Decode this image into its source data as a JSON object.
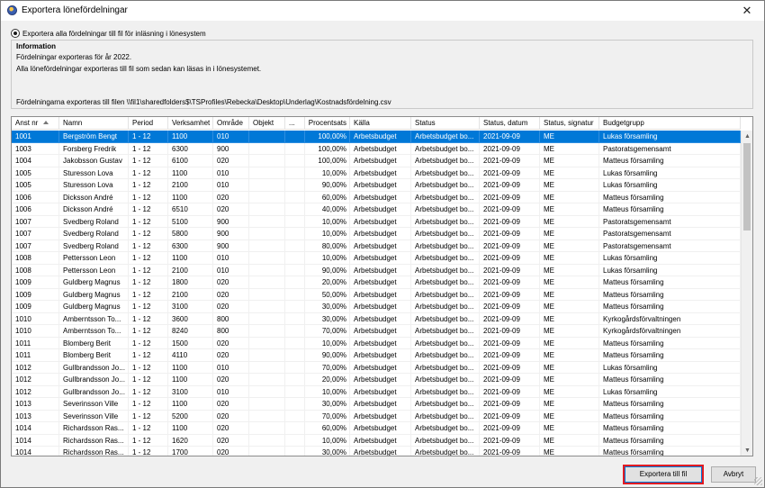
{
  "window": {
    "title": "Exportera lönefördelningar"
  },
  "option": {
    "label": "Exportera alla fördelningar till fil för inläsning i lönesystem"
  },
  "info": {
    "heading": "Information",
    "line1": "Fördelningar exporteras för år 2022.",
    "line2": "Alla lönefördelningar exporteras till fil som sedan kan läsas in i lönesystemet.",
    "line3": "Fördelningarna exporteras till filen \\\\fil1\\sharedfolders$\\TSProfiles\\Rebecka\\Desktop\\Underlag\\Kostnadsfördelning.csv"
  },
  "table": {
    "headers": [
      "Anst nr",
      "Namn",
      "Period",
      "Verksamhet",
      "Område",
      "Objekt",
      "...",
      "Procentsats",
      "Källa",
      "Status",
      "Status, datum",
      "Status, signatur",
      "Budgetgrupp"
    ],
    "rows": [
      [
        "1001",
        "Bergström Bengt",
        "1 - 12",
        "1100",
        "010",
        "",
        "",
        "100,00%",
        "Arbetsbudget",
        "Arbetsbudget bo...",
        "2021-09-09",
        "ME",
        "Lukas församling"
      ],
      [
        "1003",
        "Forsberg Fredrik",
        "1 - 12",
        "6300",
        "900",
        "",
        "",
        "100,00%",
        "Arbetsbudget",
        "Arbetsbudget bo...",
        "2021-09-09",
        "ME",
        "Pastoratsgemensamt"
      ],
      [
        "1004",
        "Jakobsson Gustav",
        "1 - 12",
        "6100",
        "020",
        "",
        "",
        "100,00%",
        "Arbetsbudget",
        "Arbetsbudget bo...",
        "2021-09-09",
        "ME",
        "Matteus församling"
      ],
      [
        "1005",
        "Sturesson Lova",
        "1 - 12",
        "1100",
        "010",
        "",
        "",
        "10,00%",
        "Arbetsbudget",
        "Arbetsbudget bo...",
        "2021-09-09",
        "ME",
        "Lukas församling"
      ],
      [
        "1005",
        "Sturesson Lova",
        "1 - 12",
        "2100",
        "010",
        "",
        "",
        "90,00%",
        "Arbetsbudget",
        "Arbetsbudget bo...",
        "2021-09-09",
        "ME",
        "Lukas församling"
      ],
      [
        "1006",
        "Dicksson André",
        "1 - 12",
        "1100",
        "020",
        "",
        "",
        "60,00%",
        "Arbetsbudget",
        "Arbetsbudget bo...",
        "2021-09-09",
        "ME",
        "Matteus församling"
      ],
      [
        "1006",
        "Dicksson André",
        "1 - 12",
        "6510",
        "020",
        "",
        "",
        "40,00%",
        "Arbetsbudget",
        "Arbetsbudget bo...",
        "2021-09-09",
        "ME",
        "Matteus församling"
      ],
      [
        "1007",
        "Svedberg Roland",
        "1 - 12",
        "5100",
        "900",
        "",
        "",
        "10,00%",
        "Arbetsbudget",
        "Arbetsbudget bo...",
        "2021-09-09",
        "ME",
        "Pastoratsgemensamt"
      ],
      [
        "1007",
        "Svedberg Roland",
        "1 - 12",
        "5800",
        "900",
        "",
        "",
        "10,00%",
        "Arbetsbudget",
        "Arbetsbudget bo...",
        "2021-09-09",
        "ME",
        "Pastoratsgemensamt"
      ],
      [
        "1007",
        "Svedberg Roland",
        "1 - 12",
        "6300",
        "900",
        "",
        "",
        "80,00%",
        "Arbetsbudget",
        "Arbetsbudget bo...",
        "2021-09-09",
        "ME",
        "Pastoratsgemensamt"
      ],
      [
        "1008",
        "Pettersson Leon",
        "1 - 12",
        "1100",
        "010",
        "",
        "",
        "10,00%",
        "Arbetsbudget",
        "Arbetsbudget bo...",
        "2021-09-09",
        "ME",
        "Lukas församling"
      ],
      [
        "1008",
        "Pettersson Leon",
        "1 - 12",
        "2100",
        "010",
        "",
        "",
        "90,00%",
        "Arbetsbudget",
        "Arbetsbudget bo...",
        "2021-09-09",
        "ME",
        "Lukas församling"
      ],
      [
        "1009",
        "Guldberg Magnus",
        "1 - 12",
        "1800",
        "020",
        "",
        "",
        "20,00%",
        "Arbetsbudget",
        "Arbetsbudget bo...",
        "2021-09-09",
        "ME",
        "Matteus församling"
      ],
      [
        "1009",
        "Guldberg Magnus",
        "1 - 12",
        "2100",
        "020",
        "",
        "",
        "50,00%",
        "Arbetsbudget",
        "Arbetsbudget bo...",
        "2021-09-09",
        "ME",
        "Matteus församling"
      ],
      [
        "1009",
        "Guldberg Magnus",
        "1 - 12",
        "3100",
        "020",
        "",
        "",
        "30,00%",
        "Arbetsbudget",
        "Arbetsbudget bo...",
        "2021-09-09",
        "ME",
        "Matteus församling"
      ],
      [
        "1010",
        "Amberntsson To...",
        "1 - 12",
        "3600",
        "800",
        "",
        "",
        "30,00%",
        "Arbetsbudget",
        "Arbetsbudget bo...",
        "2021-09-09",
        "ME",
        "Kyrkogårdsförvaltningen"
      ],
      [
        "1010",
        "Amberntsson To...",
        "1 - 12",
        "8240",
        "800",
        "",
        "",
        "70,00%",
        "Arbetsbudget",
        "Arbetsbudget bo...",
        "2021-09-09",
        "ME",
        "Kyrkogårdsförvaltningen"
      ],
      [
        "1011",
        "Blomberg Berit",
        "1 - 12",
        "1500",
        "020",
        "",
        "",
        "10,00%",
        "Arbetsbudget",
        "Arbetsbudget bo...",
        "2021-09-09",
        "ME",
        "Matteus församling"
      ],
      [
        "1011",
        "Blomberg Berit",
        "1 - 12",
        "4110",
        "020",
        "",
        "",
        "90,00%",
        "Arbetsbudget",
        "Arbetsbudget bo...",
        "2021-09-09",
        "ME",
        "Matteus församling"
      ],
      [
        "1012",
        "Gullbrandsson Jo...",
        "1 - 12",
        "1100",
        "010",
        "",
        "",
        "70,00%",
        "Arbetsbudget",
        "Arbetsbudget bo...",
        "2021-09-09",
        "ME",
        "Lukas församling"
      ],
      [
        "1012",
        "Gullbrandsson Jo...",
        "1 - 12",
        "1100",
        "020",
        "",
        "",
        "20,00%",
        "Arbetsbudget",
        "Arbetsbudget bo...",
        "2021-09-09",
        "ME",
        "Matteus församling"
      ],
      [
        "1012",
        "Gullbrandsson Jo...",
        "1 - 12",
        "3100",
        "010",
        "",
        "",
        "10,00%",
        "Arbetsbudget",
        "Arbetsbudget bo...",
        "2021-09-09",
        "ME",
        "Lukas församling"
      ],
      [
        "1013",
        "Severinsson Ville",
        "1 - 12",
        "1100",
        "020",
        "",
        "",
        "30,00%",
        "Arbetsbudget",
        "Arbetsbudget bo...",
        "2021-09-09",
        "ME",
        "Matteus församling"
      ],
      [
        "1013",
        "Severinsson Ville",
        "1 - 12",
        "5200",
        "020",
        "",
        "",
        "70,00%",
        "Arbetsbudget",
        "Arbetsbudget bo...",
        "2021-09-09",
        "ME",
        "Matteus församling"
      ],
      [
        "1014",
        "Richardsson Ras...",
        "1 - 12",
        "1100",
        "020",
        "",
        "",
        "60,00%",
        "Arbetsbudget",
        "Arbetsbudget bo...",
        "2021-09-09",
        "ME",
        "Matteus församling"
      ],
      [
        "1014",
        "Richardsson Ras...",
        "1 - 12",
        "1620",
        "020",
        "",
        "",
        "10,00%",
        "Arbetsbudget",
        "Arbetsbudget bo...",
        "2021-09-09",
        "ME",
        "Matteus församling"
      ],
      [
        "1014",
        "Richardsson Ras...",
        "1 - 12",
        "1700",
        "020",
        "",
        "",
        "30,00%",
        "Arbetsbudget",
        "Arbetsbudget bo...",
        "2021-09-09",
        "ME",
        "Matteus församling"
      ]
    ],
    "selected_row": 0
  },
  "buttons": {
    "export_label": "Exportera till fil",
    "cancel_label": "Avbryt"
  },
  "icons": {
    "app": "app-globe-icon",
    "close": "close-icon",
    "sort": "sort-ascending-icon",
    "scroll_up": "chevron-up-icon",
    "scroll_down": "chevron-down-icon"
  },
  "colors": {
    "selection": "#0078d7",
    "highlight_outline": "#e11b22"
  }
}
